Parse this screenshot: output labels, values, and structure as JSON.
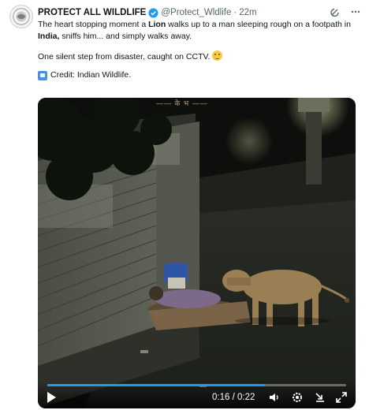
{
  "tweet": {
    "display_name": "PROTECT ALL WILDLIFE",
    "handle": "@Protect_Wldlife",
    "separator": "·",
    "time": "22m",
    "text": {
      "line1_a": "The heart stopping moment a ",
      "line1_bold": "Lion",
      "line1_b": " walks up to a man sleeping rough on a footpath in ",
      "line1_bold2": "India,",
      "line1_c": " sniffs him...  and simply walks away.",
      "para2": "One silent step from disaster, caught on CCTV.",
      "credit": "Credit: Indian Wildlife."
    },
    "icons": {
      "verified": "verified-badge-icon",
      "grok": "grok-icon",
      "more": "more-icon",
      "credit": "camera-icon",
      "emoji": "flushed-face-icon"
    }
  },
  "video": {
    "caption_overlay": "—— के भ ——",
    "current_time": "0:16",
    "duration": "0:22",
    "time_separator": " / ",
    "progress": 0.727,
    "icons": {
      "play": "play-icon",
      "volume": "volume-icon",
      "settings": "settings-icon",
      "download": "download-icon",
      "fullscreen": "fullscreen-icon"
    }
  },
  "colors": {
    "accent": "#1d9bf0",
    "text": "#0f1419",
    "secondary": "#536471"
  }
}
